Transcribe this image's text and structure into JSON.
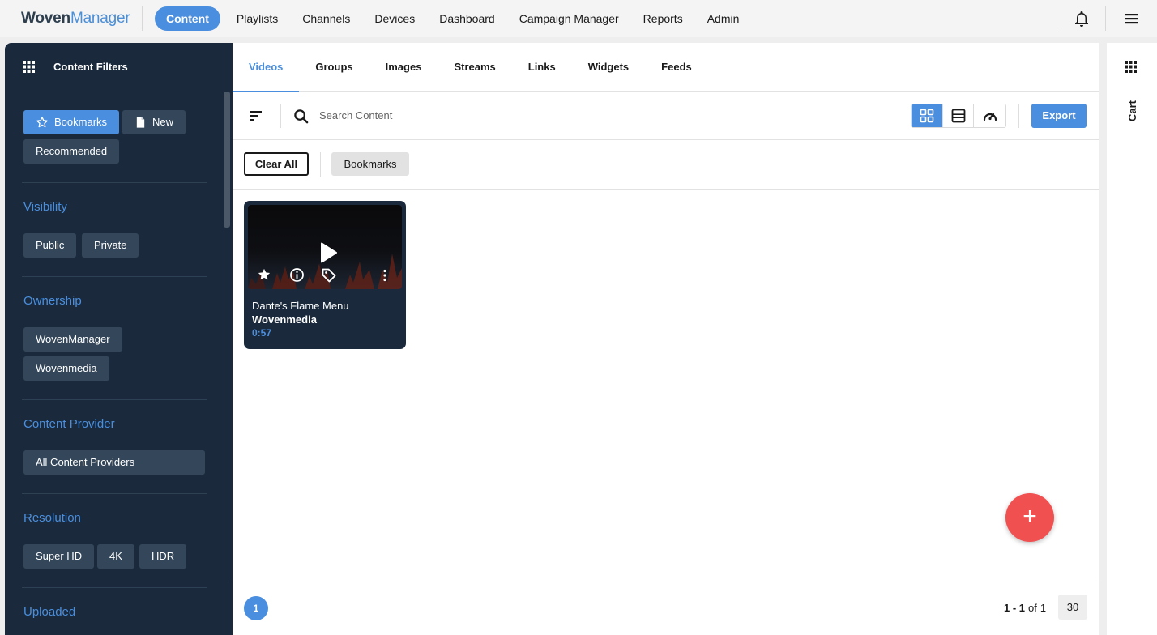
{
  "app": {
    "brand_woven": "Woven",
    "brand_manager": "Manager"
  },
  "nav": {
    "items": [
      {
        "label": "Content",
        "active": true
      },
      {
        "label": "Playlists"
      },
      {
        "label": "Channels"
      },
      {
        "label": "Devices"
      },
      {
        "label": "Dashboard"
      },
      {
        "label": "Campaign Manager"
      },
      {
        "label": "Reports"
      },
      {
        "label": "Admin"
      }
    ],
    "icons": [
      "bell-icon",
      "hamburger-menu-icon"
    ]
  },
  "sidebar": {
    "title": "Content Filters",
    "quick_filters": [
      {
        "label": "Bookmarks",
        "icon": "star-icon",
        "selected": true
      },
      {
        "label": "New",
        "icon": "document-icon"
      },
      {
        "label": "Recommended"
      }
    ],
    "sections": [
      {
        "title": "Visibility",
        "chips": [
          "Public",
          "Private"
        ]
      },
      {
        "title": "Ownership",
        "chips": [
          "WovenManager",
          "Wovenmedia"
        ]
      },
      {
        "title": "Content Provider",
        "chips": [
          "All Content Providers"
        ]
      },
      {
        "title": "Resolution",
        "chips": [
          "Super HD",
          "4K",
          "HDR"
        ]
      },
      {
        "title": "Uploaded",
        "chips": []
      }
    ]
  },
  "tabs": [
    {
      "label": "Videos",
      "active": true
    },
    {
      "label": "Groups"
    },
    {
      "label": "Images"
    },
    {
      "label": "Streams"
    },
    {
      "label": "Links"
    },
    {
      "label": "Widgets"
    },
    {
      "label": "Feeds"
    }
  ],
  "toolbar": {
    "search_placeholder": "Search Content",
    "view_modes": [
      "grid-view-icon",
      "list-view-icon",
      "speedometer-icon"
    ],
    "active_view": "grid-view-icon",
    "export_label": "Export"
  },
  "filters_bar": {
    "clear_all_label": "Clear All",
    "active_filters": [
      "Bookmarks"
    ]
  },
  "content": [
    {
      "title": "Dante's Flame Menu",
      "owner": "Wovenmedia",
      "duration": "0:57",
      "icons": [
        "play-icon",
        "star-icon",
        "info-icon",
        "tag-icon",
        "more-vertical-icon"
      ]
    }
  ],
  "pagination": {
    "current_page": "1",
    "range_start_end": "1 - 1",
    "of_label": "of",
    "total": "1",
    "per_page": "30"
  },
  "fab_label": "+",
  "right_panel": {
    "cart_label": "Cart"
  },
  "colors": {
    "accent": "#4a8fdf",
    "sidebar_bg": "#1a2a3c",
    "chip_bg": "#34475a",
    "fab": "#f0504f"
  }
}
